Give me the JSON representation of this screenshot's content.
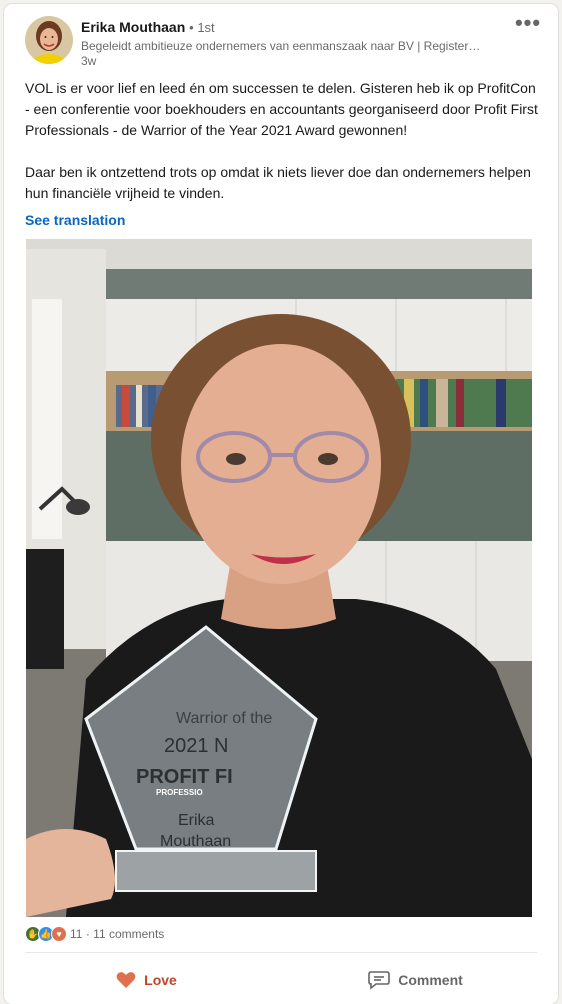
{
  "post": {
    "author": {
      "name": "Erika Mouthaan",
      "degree": "1st",
      "headline": "Begeleidt ambitieuze ondernemers van eenmanszaak naar BV | Register…",
      "time": "3w"
    },
    "more_icon": "ellipsis-icon",
    "paragraphs": [
      "VOL is er voor lief en leed én om successen te delen. Gisteren heb ik op ProfitCon - een conferentie voor boekhouders en accountants georganiseerd door Profit First Professionals - de Warrior of the Year 2021 Award gewonnen!",
      "Daar ben ik ontzettend trots op omdat ik niets liever doe dan ondernemers helpen hun financiële vrijheid te vinden."
    ],
    "see_translation": "See translation",
    "photo": {
      "award_lines": [
        "Warrior of the",
        "2021 N",
        "PROFIT FI",
        "PROFESSIO",
        "Erika",
        "Mouthaan"
      ]
    }
  },
  "social": {
    "reaction_icons": [
      "celebrate-icon",
      "like-icon",
      "love-icon"
    ],
    "reaction_count": "11",
    "separator": "·",
    "comments": "11 comments"
  },
  "actions": {
    "love_label": "Love",
    "comment_label": "Comment"
  },
  "colors": {
    "link": "#0a66c2",
    "love": "#c0462b",
    "celebrate": "#44712e",
    "like": "#378fe9"
  }
}
